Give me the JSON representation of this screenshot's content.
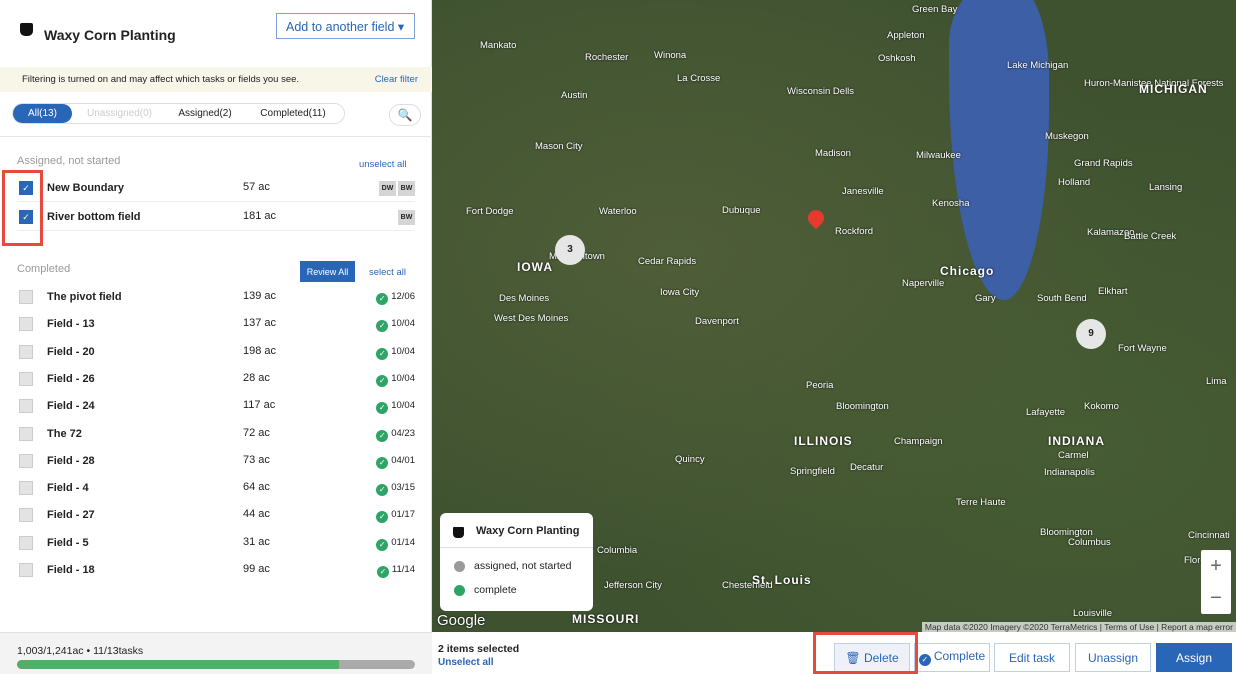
{
  "header": {
    "title": "Waxy Corn Planting",
    "add_button": "Add to another field ▾"
  },
  "filter": {
    "message": "Filtering is turned on and may affect which tasks or fields you see.",
    "clear": "Clear filter"
  },
  "tabs": [
    {
      "label": "All(13)"
    },
    {
      "label": "Unassigned(0)"
    },
    {
      "label": "Assigned(2)"
    },
    {
      "label": "Completed(11)"
    }
  ],
  "search_icon": "🔍",
  "assigned": {
    "heading": "Assigned, not started",
    "action": "unselect all",
    "rows": [
      {
        "name": "New Boundary",
        "acres": "57 ac",
        "badges": [
          "DW",
          "BW"
        ]
      },
      {
        "name": "River bottom field",
        "acres": "181 ac",
        "badges": [
          "BW"
        ]
      }
    ]
  },
  "completed": {
    "heading": "Completed",
    "review": "Review All",
    "action": "select all",
    "rows": [
      {
        "name": "The pivot field",
        "acres": "139 ac",
        "date": "12/06"
      },
      {
        "name": "Field - 13",
        "acres": "137 ac",
        "date": "10/04"
      },
      {
        "name": "Field - 20",
        "acres": "198 ac",
        "date": "10/04"
      },
      {
        "name": "Field - 26",
        "acres": "28 ac",
        "date": "10/04"
      },
      {
        "name": "Field - 24",
        "acres": "117 ac",
        "date": "10/04"
      },
      {
        "name": "The 72",
        "acres": "72 ac",
        "date": "04/23"
      },
      {
        "name": "Field - 28",
        "acres": "73 ac",
        "date": "04/01"
      },
      {
        "name": "Field - 4",
        "acres": "64 ac",
        "date": "03/15"
      },
      {
        "name": "Field - 27",
        "acres": "44 ac",
        "date": "01/17"
      },
      {
        "name": "Field - 5",
        "acres": "31 ac",
        "date": "01/14"
      },
      {
        "name": "Field - 18",
        "acres": "99 ac",
        "date": "11/14"
      }
    ]
  },
  "footer": {
    "summary": "1,003/1,241ac • 11/13tasks",
    "progress_percent": 80.8
  },
  "map": {
    "labels": [
      [
        "Green Bay",
        480,
        4,
        0
      ],
      [
        "Appleton",
        455,
        30,
        0
      ],
      [
        "Oshkosh",
        446,
        53,
        0
      ],
      [
        "Mankato",
        48,
        40,
        0
      ],
      [
        "Rochester",
        153,
        52,
        0
      ],
      [
        "Winona",
        222,
        50,
        0
      ],
      [
        "La Crosse",
        245,
        73,
        0
      ],
      [
        "Austin",
        129,
        90,
        0
      ],
      [
        "Wisconsin Dells",
        355,
        86,
        0
      ],
      [
        "Huron-Manistee National Forests",
        652,
        78,
        0
      ],
      [
        "MICHIGAN",
        707,
        82,
        1
      ],
      [
        "Muskegon",
        613,
        131,
        0
      ],
      [
        "Mason City",
        103,
        141,
        0
      ],
      [
        "Madison",
        383,
        148,
        0
      ],
      [
        "Milwaukee",
        484,
        150,
        0
      ],
      [
        "Grand Rapids",
        642,
        158,
        0
      ],
      [
        "Holland",
        626,
        177,
        0
      ],
      [
        "Lansing",
        717,
        182,
        0
      ],
      [
        "Janesville",
        410,
        186,
        0
      ],
      [
        "Kenosha",
        500,
        198,
        0
      ],
      [
        "Fort Dodge",
        34,
        206,
        0
      ],
      [
        "Waterloo",
        167,
        206,
        0
      ],
      [
        "Dubuque",
        290,
        205,
        0
      ],
      [
        "Rockford",
        403,
        226,
        0
      ],
      [
        "Kalamazoo",
        655,
        227,
        0
      ],
      [
        "Battle Creek",
        692,
        231,
        0
      ],
      [
        "Marshalltown",
        117,
        251,
        0
      ],
      [
        "Cedar Rapids",
        206,
        256,
        0
      ],
      [
        "Chicago",
        508,
        264,
        1
      ],
      [
        "IOWA",
        85,
        260,
        1
      ],
      [
        "Naperville",
        470,
        278,
        0
      ],
      [
        "Elkhart",
        666,
        286,
        0
      ],
      [
        "Des Moines",
        67,
        293,
        0
      ],
      [
        "Iowa City",
        228,
        287,
        0
      ],
      [
        "Gary",
        543,
        293,
        0
      ],
      [
        "South Bend",
        605,
        293,
        0
      ],
      [
        "West Des Moines",
        62,
        313,
        0
      ],
      [
        "Davenport",
        263,
        316,
        0
      ],
      [
        "Fort Wayne",
        686,
        343,
        0
      ],
      [
        "Peoria",
        374,
        380,
        0
      ],
      [
        "Bloomington",
        404,
        401,
        0
      ],
      [
        "Lafayette",
        594,
        407,
        0
      ],
      [
        "Kokomo",
        652,
        401,
        0
      ],
      [
        "Lima",
        774,
        376,
        0
      ],
      [
        "ILLINOIS",
        362,
        434,
        1
      ],
      [
        "INDIANA",
        616,
        434,
        1
      ],
      [
        "Champaign",
        462,
        436,
        0
      ],
      [
        "Carmel",
        626,
        450,
        0
      ],
      [
        "Quincy",
        243,
        454,
        0
      ],
      [
        "Springfield",
        358,
        466,
        0
      ],
      [
        "Decatur",
        418,
        462,
        0
      ],
      [
        "Indianapolis",
        612,
        467,
        0
      ],
      [
        "Terre Haute",
        524,
        497,
        0
      ],
      [
        "Bloomington",
        608,
        527,
        0
      ],
      [
        "Columbus",
        636,
        537,
        0
      ],
      [
        "Cincinnati",
        756,
        530,
        0
      ],
      [
        "Columbia",
        165,
        545,
        0
      ],
      [
        "Florence",
        752,
        555,
        0
      ],
      [
        "Jefferson City",
        172,
        580,
        0
      ],
      [
        "Chesterfield",
        290,
        580,
        0
      ],
      [
        "St. Louis",
        320,
        573,
        1
      ],
      [
        "Louisville",
        641,
        608,
        0
      ],
      [
        "MISSOURI",
        140,
        612,
        1
      ],
      [
        "Lake Michigan",
        575,
        60,
        0
      ]
    ],
    "clusters": [
      {
        "count": "3"
      },
      {
        "count": "9"
      }
    ],
    "legend": {
      "title": "Waxy Corn Planting",
      "items": [
        {
          "label": "assigned, not started",
          "color": "#9a9a9a"
        },
        {
          "label": "complete",
          "color": "#2ea567"
        }
      ]
    },
    "zoom_in": "+",
    "zoom_out": "−",
    "google": "Google",
    "attribution": "Map data ©2020 Imagery ©2020 TerraMetrics | Terms of Use | Report a map error"
  },
  "bottom": {
    "selected": "2 items selected",
    "unselect": "Unselect all",
    "delete": "Delete",
    "complete": "Complete",
    "edit": "Edit task",
    "unassign": "Unassign",
    "assign": "Assign"
  },
  "colors": {
    "accent": "#2a66b8",
    "success": "#2ea567",
    "highlight": "#e8493c"
  }
}
